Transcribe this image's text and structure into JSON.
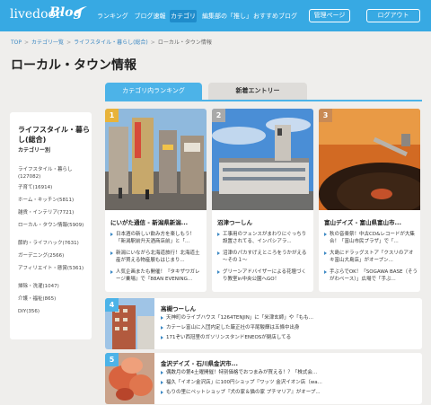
{
  "header": {
    "logo": "livedoor",
    "logo_blog": "Blog",
    "nav": [
      "ランキング",
      "ブログ速報",
      "カテゴリ",
      "編集部の「推し」",
      "おすすめブログ"
    ],
    "btn_manage": "管理ページ",
    "btn_logout": "ログアウト"
  },
  "breadcrumb": [
    "TOP",
    "カテゴリ一覧",
    "ライフスタイル・暮らし(総合)",
    "ローカル・タウン情報"
  ],
  "page_title": "ローカル・タウン情報",
  "tabs": {
    "ranking": "カテゴリ内ランキング",
    "new": "新着エントリー"
  },
  "sidebar": {
    "title": "ライフスタイル・暮らし(総合)",
    "subtitle": "カテゴリー別",
    "items": [
      "ライフスタイル・暮らし(127082)",
      "子育て(16914)",
      "ホーム・キッチン(5811)",
      "雑貨・インテリア(7721)",
      "ローカル・タウン情報(5909)",
      "節約・ライフハック(7631)",
      "ガーデニング(2566)",
      "アフィリエイト・懸賞(5361)",
      "掃除・洗濯(1047)",
      "介護・福祉(865)",
      "DIY(356)"
    ]
  },
  "cards": [
    {
      "rank": "1",
      "title": "にいがた通信 - 新潟県新潟...",
      "bullets": [
        "日本酒の新しい飲み方を楽しもう！「新潟駅前升天酒商店前」と「...",
        "新潟にいながら北海道旅行！北海道土産が買える物産展もはじまり...",
        "人気企画またも開催！『タキザワガレージ乗場』で『88AN EVENING..."
      ]
    },
    {
      "rank": "2",
      "title": "沼津つーしん",
      "bullets": [
        "工事用のフェンスがまわりにぐっちり設置されてる、インパシアラ...",
        "沼津のパカすげえところをうかがえる～その１～",
        "グリーンアドバイザーによる花壇づくり教室in中央公園へGO！"
      ]
    },
    {
      "rank": "3",
      "title": "富山デイズ - 富山県富山市...",
      "bullets": [
        "秋の音楽祭！中古CD&レコードが大集合！「富山市民プラザ」で「...",
        "大島にドラッグストア「クスリのアオキ富山大島店」がオープン...",
        "手ぶらでOK！「SOGAWA BASE（そうがわベース）」広場で「手ぶ..."
      ]
    }
  ],
  "wide_cards": [
    {
      "rank": "4",
      "title": "高槻つーしん",
      "bullets": [
        "天神町のライブハウス「1264TENJIN」に「米津玄師」や「もも...",
        "カテーレ富山に入団内定した厳正社の平尾駿輝は五條中出身",
        "171ぞい西冠里のガソリンスタンドENEOSが閉店してる"
      ]
    },
    {
      "rank": "5",
      "title": "金沢デイズ - 石川県金沢市...",
      "bullets": [
        "偶数月の第4土曜開催！特別価格でおつまみが買える！？「株式会...",
        "福久「イオン金沢店」に100円ショップ『ワッツ 金沢イオン店（wa...",
        "もりの里にペットショップ『犬の家＆猫の家 プチマリア』がオープ..."
      ]
    }
  ]
}
